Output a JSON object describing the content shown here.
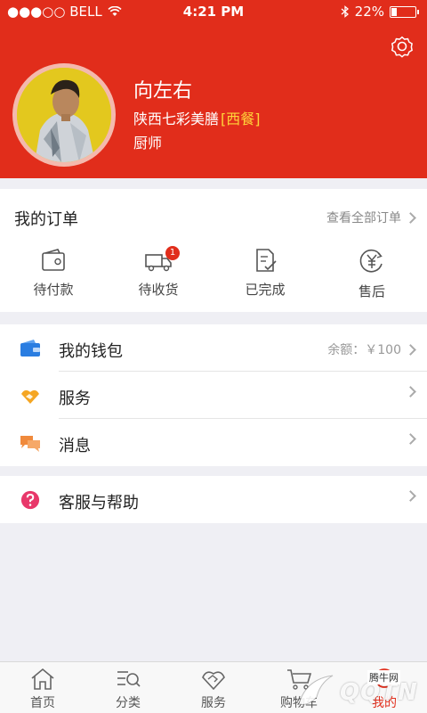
{
  "status_bar": {
    "carrier": "●●●○○ BELL",
    "time": "4:21 PM",
    "battery_percent": "22%",
    "battery_level": 0.22
  },
  "profile": {
    "name": "向左右",
    "shop": "陕西七彩美膳",
    "shop_tag": "[西餐]",
    "role": "厨师"
  },
  "orders": {
    "title": "我的订单",
    "view_all": "查看全部订单",
    "items": [
      {
        "label": "待付款",
        "icon": "wallet-icon"
      },
      {
        "label": "待收货",
        "icon": "truck-icon",
        "badge": "1"
      },
      {
        "label": "已完成",
        "icon": "checklist-icon"
      },
      {
        "label": "售后",
        "icon": "yuan-return-icon"
      }
    ]
  },
  "menu": {
    "wallet": {
      "label": "我的钱包",
      "balance": "余额：￥100",
      "icon": "wallet-blue-icon"
    },
    "service": {
      "label": "服务",
      "icon": "handshake-icon"
    },
    "messages": {
      "label": "消息",
      "icon": "chat-bubbles-icon"
    },
    "help": {
      "label": "客服与帮助",
      "icon": "help-icon"
    }
  },
  "tabbar": {
    "items": [
      {
        "label": "首页",
        "icon": "home-icon"
      },
      {
        "label": "分类",
        "icon": "category-search-icon"
      },
      {
        "label": "服务",
        "icon": "handshake-outline-icon"
      },
      {
        "label": "购物车",
        "icon": "cart-icon"
      },
      {
        "label": "我的",
        "icon": "profile-icon"
      }
    ]
  },
  "watermark": {
    "text": "QQTN",
    "small": "腾牛网"
  },
  "colors": {
    "brand_red": "#e12d1b",
    "shop_tag_yellow": "#ffd53a",
    "help_pink": "#e8386a",
    "wallet_blue": "#2a7de1",
    "service_orange": "#f5a623"
  }
}
